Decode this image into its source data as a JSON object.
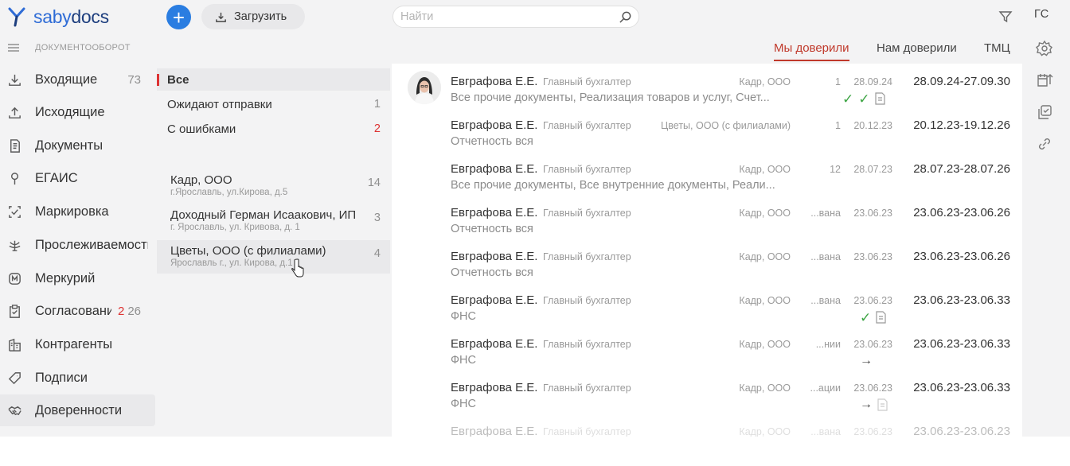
{
  "brand": {
    "prefix": "saby",
    "suffix": "docs"
  },
  "nav": {
    "section": "ДОКУМЕНТООБОРОТ",
    "items": [
      {
        "label": "Входящие",
        "count": "73"
      },
      {
        "label": "Исходящие",
        "count": ""
      },
      {
        "label": "Документы",
        "count": ""
      },
      {
        "label": "ЕГАИС",
        "count": ""
      },
      {
        "label": "Маркировка",
        "count": ""
      },
      {
        "label": "Прослеживаемость",
        "count": ""
      },
      {
        "label": "Меркурий",
        "count": ""
      },
      {
        "label": "Согласования",
        "count_red": "2",
        "count": "26"
      },
      {
        "label": "Контрагенты",
        "count": ""
      },
      {
        "label": "Подписи",
        "count": ""
      },
      {
        "label": "Доверенности",
        "count": ""
      }
    ]
  },
  "toolbar": {
    "upload_label": "Загрузить",
    "search_placeholder": "Найти",
    "user_initials": "ГС"
  },
  "tabs": [
    {
      "label": "Мы доверили",
      "active": true
    },
    {
      "label": "Нам доверили",
      "active": false
    },
    {
      "label": "ТМЦ",
      "active": false
    }
  ],
  "filters": [
    {
      "label": "Все",
      "count": "",
      "active": true
    },
    {
      "label": "Ожидают отправки",
      "count": "1"
    },
    {
      "label": "С ошибками",
      "count": "2",
      "red": true
    }
  ],
  "orgs": [
    {
      "name": "Кадр, ООО",
      "address": "г.Ярославль, ул.Кирова, д.5",
      "count": "14"
    },
    {
      "name": "Доходный Герман Исаакович, ИП",
      "address": "г. Ярославль, ул. Кривова, д. 1",
      "count": "3"
    },
    {
      "name": "Цветы, ООО (с филиалами)",
      "address": "Ярославль г., ул. Кирова, д.1",
      "count": "4"
    }
  ],
  "documents": [
    {
      "author": "Евграфова Е.Е.",
      "role": "Главный бухгалтер",
      "description": "Все прочие документы, Реализация товаров и услуг, Счет...",
      "org": "Кадр, ООО",
      "num": "1",
      "date": "28.09.24",
      "range": "28.09.24-27.09.30",
      "status": [
        "check",
        "check",
        "doc"
      ]
    },
    {
      "author": "Евграфова Е.Е.",
      "role": "Главный бухгалтер",
      "description": "Отчетность вся",
      "org": "Цветы, ООО (с филиалами)",
      "num": "1",
      "date": "20.12.23",
      "range": "20.12.23-19.12.26",
      "status": []
    },
    {
      "author": "Евграфова Е.Е.",
      "role": "Главный бухгалтер",
      "description": "Все прочие документы, Все внутренние документы, Реали...",
      "org": "Кадр, ООО",
      "num": "12",
      "date": "28.07.23",
      "range": "28.07.23-28.07.26",
      "status": []
    },
    {
      "author": "Евграфова Е.Е.",
      "role": "Главный бухгалтер",
      "description": "Отчетность вся",
      "org": "Кадр, ООО",
      "num": "...вана",
      "date": "23.06.23",
      "range": "23.06.23-23.06.26",
      "status": []
    },
    {
      "author": "Евграфова Е.Е.",
      "role": "Главный бухгалтер",
      "description": "Отчетность вся",
      "org": "Кадр, ООО",
      "num": "...вана",
      "date": "23.06.23",
      "range": "23.06.23-23.06.26",
      "status": []
    },
    {
      "author": "Евграфова Е.Е.",
      "role": "Главный бухгалтер",
      "description": "ФНС",
      "org": "Кадр, ООО",
      "num": "...вана",
      "date": "23.06.23",
      "range": "23.06.23-23.06.33",
      "status": [
        "check",
        "doc"
      ]
    },
    {
      "author": "Евграфова Е.Е.",
      "role": "Главный бухгалтер",
      "description": "ФНС",
      "org": "Кадр, ООО",
      "num": "...нии",
      "date": "23.06.23",
      "range": "23.06.23-23.06.33",
      "status": [
        "arrow"
      ]
    },
    {
      "author": "Евграфова Е.Е.",
      "role": "Главный бухгалтер",
      "description": "ФНС",
      "org": "Кадр, ООО",
      "num": "...ации",
      "date": "23.06.23",
      "range": "23.06.23-23.06.33",
      "status": [
        "arrow",
        "doc"
      ]
    },
    {
      "author": "Евграфова Е.Е.",
      "role": "Главный бухгалтер",
      "description": "",
      "org": "Кадр, ООО",
      "num": "...вана",
      "date": "23.06.23",
      "range": "23.06.23-23.06.23",
      "status": []
    }
  ]
}
